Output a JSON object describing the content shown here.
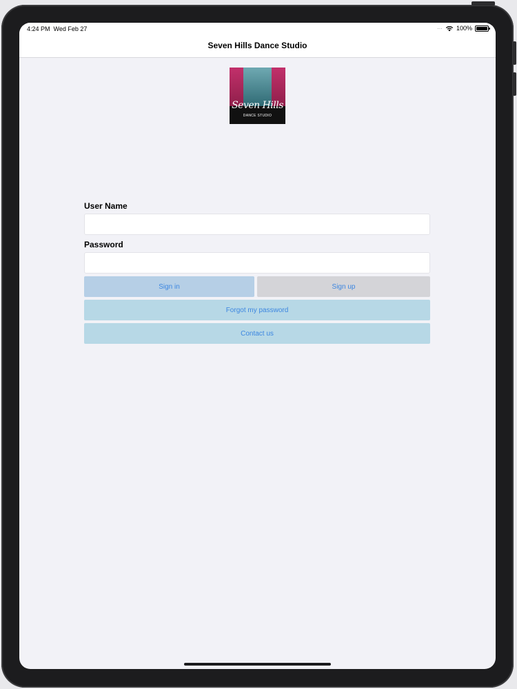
{
  "status_bar": {
    "time": "4:24 PM",
    "date": "Wed Feb 27",
    "dots": "···",
    "battery": "100%"
  },
  "nav": {
    "title": "Seven Hills Dance Studio"
  },
  "logo": {
    "script_text": "Seven Hills",
    "sub_text": "DANCE STUDIO"
  },
  "form": {
    "username_label": "User Name",
    "username_value": "",
    "password_label": "Password",
    "password_value": ""
  },
  "buttons": {
    "sign_in": "Sign in",
    "sign_up": "Sign up",
    "forgot": "Forgot my password",
    "contact": "Contact us"
  },
  "colors": {
    "accent_text": "#3c86e0",
    "sign_in_bg": "#b6cfe6",
    "sign_up_bg": "#d4d4d8",
    "secondary_bg": "#b7d8e6",
    "screen_bg": "#f2f2f7"
  }
}
